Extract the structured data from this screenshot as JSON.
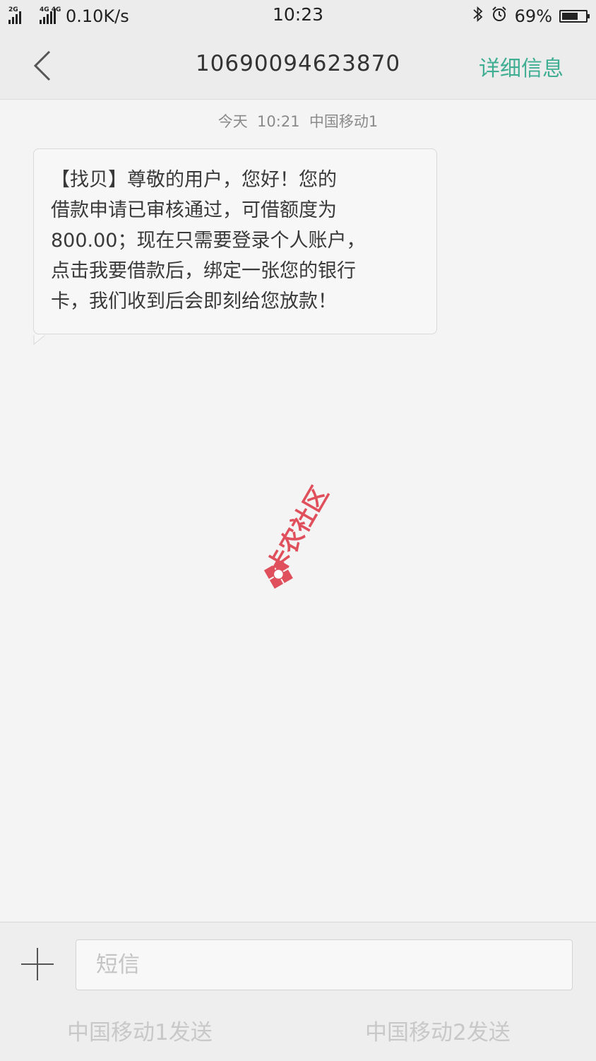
{
  "status_bar": {
    "sim1_tag": "2G",
    "sim2_tag": "4G 4G",
    "net_speed": "0.10K/s",
    "time": "10:23",
    "battery_percent": "69%",
    "battery_level": 0.69,
    "icons": [
      "signal-icon",
      "signal-icon",
      "bluetooth-icon",
      "alarm-icon",
      "battery-icon"
    ]
  },
  "header": {
    "title": "10690094623870",
    "detail_label": "详细信息",
    "back_icon": "chevron-left-icon"
  },
  "conversation": {
    "timestamp": "今天  10:21  中国移动1",
    "messages": [
      {
        "lines": [
          "【找贝】尊敬的用户，您好！您的",
          "借款申请已审核通过，可借额度为",
          "800.00；现在只需要登录个人账户，",
          "点击我要借款后，绑定一张您的银行",
          "卡，我们收到后会即刻给您放款！"
        ]
      }
    ]
  },
  "watermark": {
    "text": "卡农社区"
  },
  "composer": {
    "placeholder": "短信",
    "send_sim1": "中国移动1发送",
    "send_sim2": "中国移动2发送"
  },
  "colors": {
    "accent": "#3fae93",
    "logo_red": "#e0505c"
  }
}
